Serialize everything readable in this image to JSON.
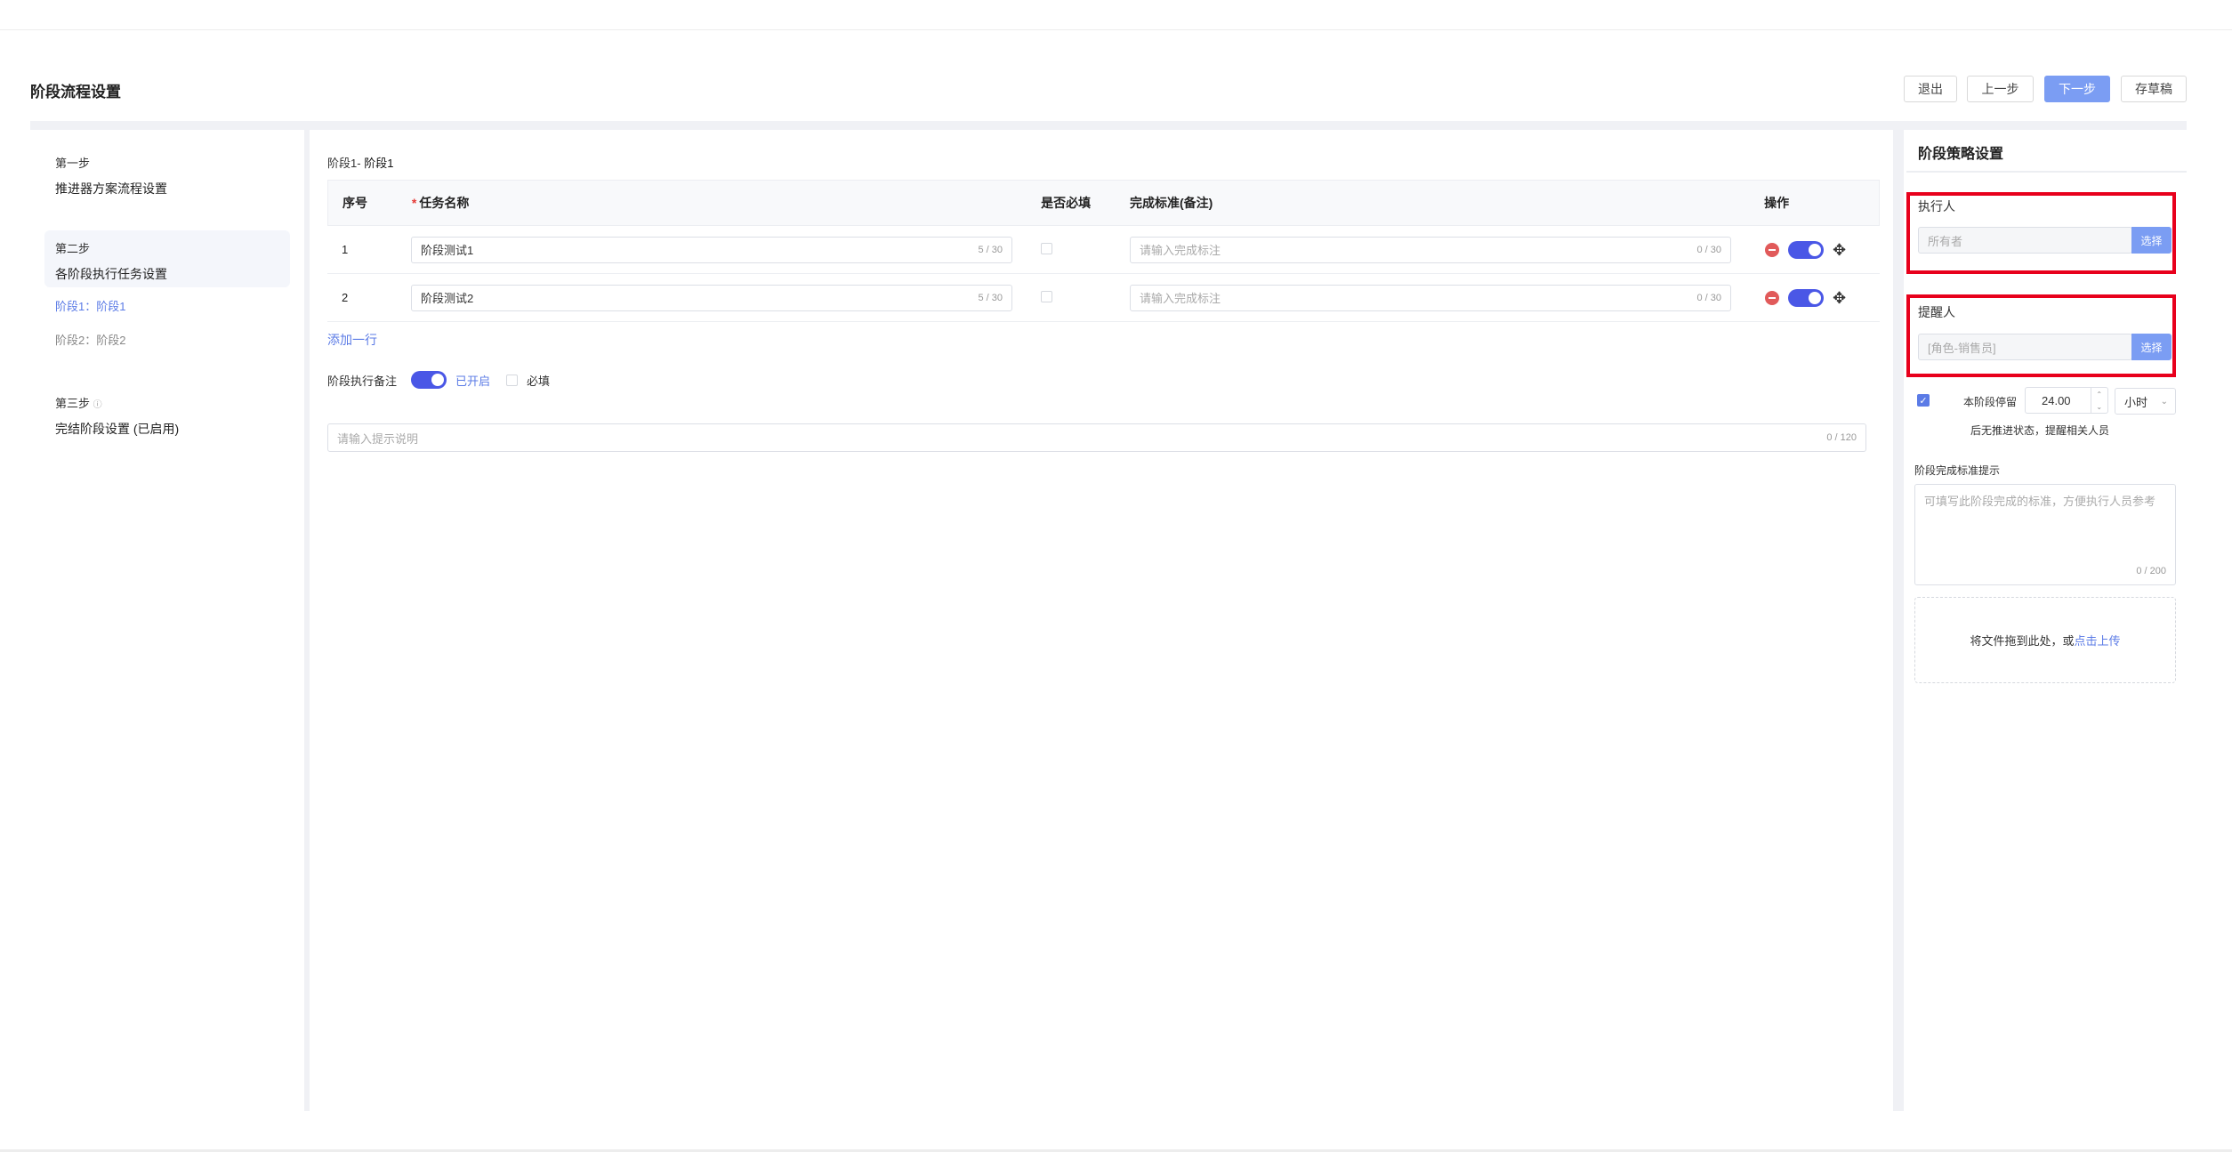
{
  "page": {
    "title": "阶段流程设置",
    "buttons": {
      "exit": "退出",
      "prev": "上一步",
      "next": "下一步",
      "draft": "存草稿"
    }
  },
  "steps": [
    {
      "label": "第一步",
      "name": "推进器方案流程设置"
    },
    {
      "label": "第二步",
      "name": "各阶段执行任务设置"
    },
    {
      "label": "第三步",
      "name": "完结阶段设置 (已启用)"
    }
  ],
  "step2_sub": [
    {
      "label": "阶段1：阶段1"
    },
    {
      "label": "阶段2：阶段2"
    }
  ],
  "step3_help_icon": "question-circle-icon",
  "stage": {
    "prefix": "阶段1-",
    "name": "阶段1"
  },
  "table": {
    "headers": {
      "seq": "序号",
      "required_mark": "*",
      "task": "任务名称",
      "must": "是否必填",
      "standard": "完成标准(备注)",
      "ops": "操作"
    },
    "rows": [
      {
        "seq": "1",
        "task": "阶段测试1",
        "task_count": "5 / 30",
        "standard_placeholder": "请输入完成标注",
        "standard_count": "0 / 30"
      },
      {
        "seq": "2",
        "task": "阶段测试2",
        "task_count": "5 / 30",
        "standard_placeholder": "请输入完成标注",
        "standard_count": "0 / 30"
      }
    ],
    "add_row": "添加一行"
  },
  "note": {
    "label": "阶段执行备注",
    "toggle_text": "已开启",
    "required_label": "必填",
    "input_placeholder": "请输入提示说明",
    "input_count": "0 / 120"
  },
  "strategy": {
    "title": "阶段策略设置",
    "executor_label": "执行人",
    "executor_value": "所有者",
    "reminder_label": "提醒人",
    "reminder_value": "[角色-销售员]",
    "select_btn": "选择",
    "stay_label": "本阶段停留",
    "stay_value": "24.00",
    "stay_unit": "小时",
    "stay_hint": "后无推进状态，提醒相关人员",
    "standard_label": "阶段完成标准提示",
    "standard_placeholder": "可填写此阶段完成的标准，方便执行人员参考",
    "standard_count": "0 / 200",
    "upload_text": "将文件拖到此处，或",
    "upload_link": "点击上传"
  },
  "colors": {
    "primary": "#7b9df3",
    "toggle": "#4a57e6",
    "danger": "#e15a5a",
    "highlight": "#e8001c"
  }
}
